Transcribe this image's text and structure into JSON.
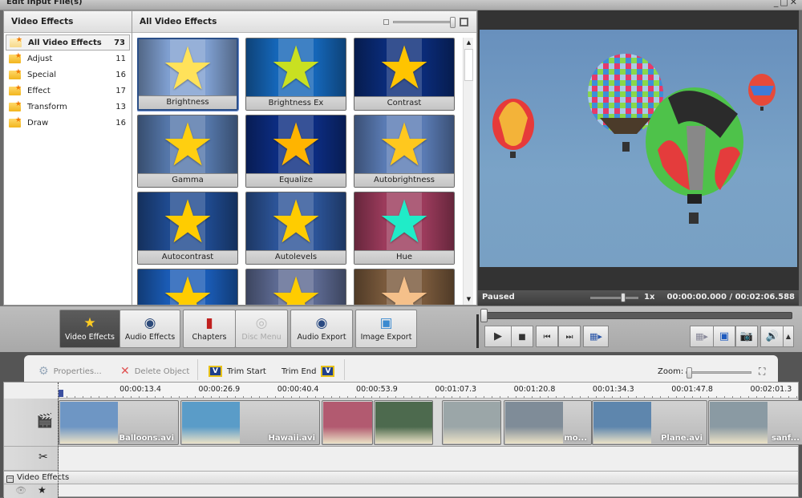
{
  "window": {
    "title": "Edit Input File(s)",
    "controls": [
      "minimize",
      "maximize",
      "close"
    ]
  },
  "categories": {
    "header": "Video Effects",
    "items": [
      {
        "label": "All Video Effects",
        "count": "73",
        "selected": true
      },
      {
        "label": "Adjust",
        "count": "11"
      },
      {
        "label": "Special",
        "count": "16"
      },
      {
        "label": "Effect",
        "count": "17"
      },
      {
        "label": "Transform",
        "count": "13"
      },
      {
        "label": "Draw",
        "count": "16"
      }
    ]
  },
  "effects": {
    "header": "All Video Effects",
    "items": [
      {
        "label": "Brightness",
        "bg": "#7f9fd0",
        "star": "#ffe25a",
        "selected": true
      },
      {
        "label": "Brightness Ex",
        "bg": "#1566b8",
        "star": "#c9e021"
      },
      {
        "label": "Contrast",
        "bg": "#0a2b78",
        "star": "#ffc400"
      },
      {
        "label": "Gamma",
        "bg": "#5577aa",
        "star": "#ffcf10"
      },
      {
        "label": "Equalize",
        "bg": "#0c2c80",
        "star": "#ffb400"
      },
      {
        "label": "Autobrightness",
        "bg": "#5a7bb4",
        "star": "#ffc81e"
      },
      {
        "label": "Autocontrast",
        "bg": "#1f4a8f",
        "star": "#ffcc00"
      },
      {
        "label": "Autolevels",
        "bg": "#2c5498",
        "star": "#ffcc00"
      },
      {
        "label": "Hue",
        "bg": "#9c3b5c",
        "star": "#20ecc8"
      },
      {
        "label": "",
        "bg": "#1a5bb5",
        "star": "#ffcc00"
      },
      {
        "label": "",
        "bg": "#5d6a92",
        "star": "#ffcc00"
      },
      {
        "label": "",
        "bg": "#7a5a3c",
        "star": "#f5c08a"
      }
    ]
  },
  "preview": {
    "status": "Paused",
    "speed": "1x",
    "current_time": "00:00:00.000",
    "separator": "/",
    "total_time": "00:02:06.588",
    "seek_position": 0
  },
  "toolbar": {
    "buttons": [
      {
        "label": "Video Effects",
        "icon": "video-effects-icon",
        "active": true
      },
      {
        "label": "Audio Effects",
        "icon": "audio-effects-icon"
      },
      {
        "label": "Chapters",
        "icon": "chapters-icon"
      },
      {
        "label": "Disc Menu",
        "icon": "disc-menu-icon",
        "disabled": true
      },
      {
        "label": "Audio Export",
        "icon": "audio-export-icon"
      },
      {
        "label": "Image Export",
        "icon": "image-export-icon"
      }
    ]
  },
  "player": {
    "play": "▶",
    "stop": "■",
    "prev": "⏮",
    "next": "⏭",
    "film": "🎞",
    "right": [
      "aspect",
      "fullscreen",
      "snapshot",
      "volume",
      "more"
    ]
  },
  "timeline": {
    "properties": "Properties...",
    "delete": "Delete Object",
    "trim_start": "Trim Start",
    "trim_end": "Trim End",
    "zoom_label": "Zoom:",
    "ruler": [
      "00:00:13.4",
      "00:00:26.9",
      "00:00:40.4",
      "00:00:53.9",
      "00:01:07.3",
      "00:01:20.8",
      "00:01:34.3",
      "00:01:47.8",
      "00:02:01.3"
    ],
    "clips": [
      {
        "name": "Balloons.avi",
        "thumb": "#6e96c4"
      },
      {
        "name": "Hawaii.avi",
        "thumb": "#5a9cc8"
      },
      {
        "name": "",
        "thumb": "#b25a70"
      },
      {
        "name": "",
        "thumb": "#4d6a4e"
      },
      {
        "name": "",
        "thumb": "#9ba6a8"
      },
      {
        "name": "mo...",
        "thumb": "#7f8c98"
      },
      {
        "name": "Plane.avi",
        "thumb": "#5e86ad"
      },
      {
        "name": "sanf...",
        "thumb": "#8a9aa3"
      }
    ],
    "fx_track": "Video Effects"
  }
}
